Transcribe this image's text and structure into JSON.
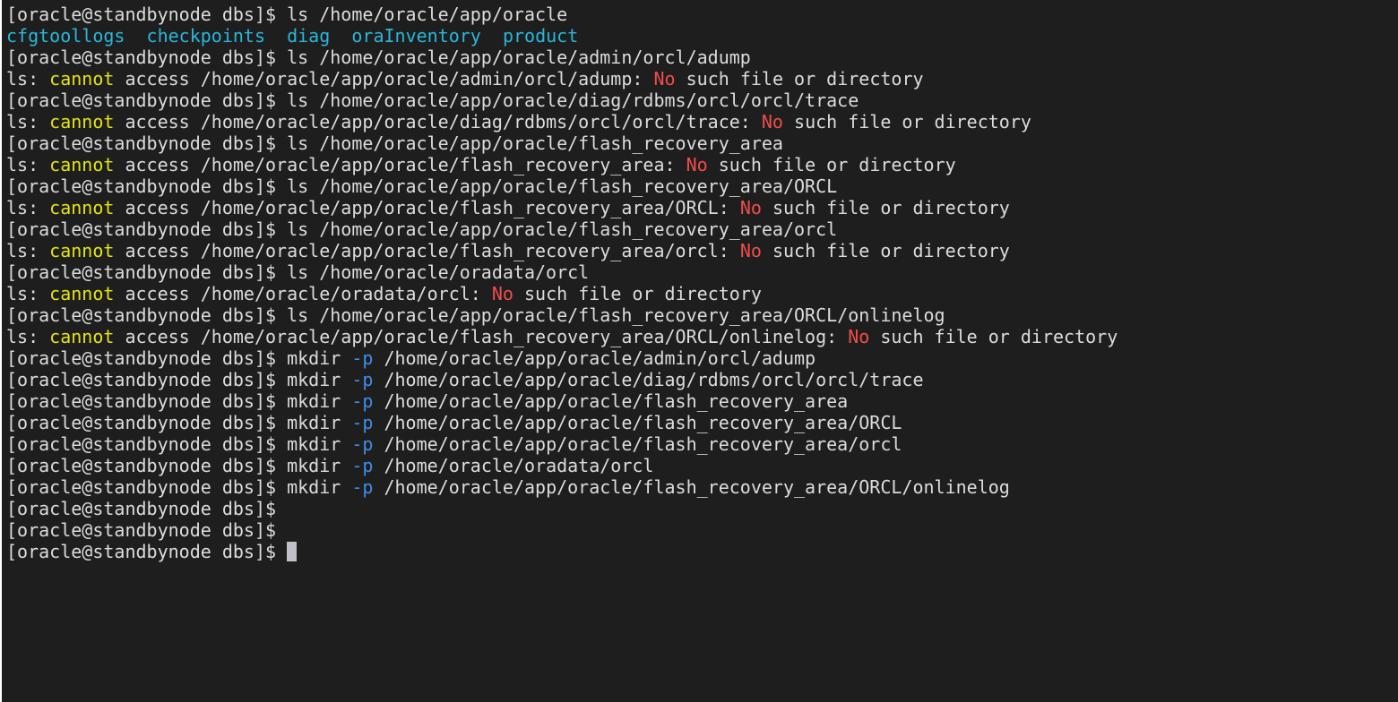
{
  "colors": {
    "background": "#1e1e1e",
    "default_text": "#dcdcdc",
    "directory": "#29b8db",
    "warning": "#e5e510",
    "error": "#f14c4c",
    "option": "#3b8eea",
    "cursor": "#c0c0c8"
  },
  "lines": [
    [
      {
        "t": "[oracle@standbynode dbs]$ ls /home/oracle/app/oracle",
        "c": "default"
      }
    ],
    [
      {
        "t": "cfgtoollogs",
        "c": "dir"
      },
      {
        "t": "  ",
        "c": "default"
      },
      {
        "t": "checkpoints",
        "c": "dir"
      },
      {
        "t": "  ",
        "c": "default"
      },
      {
        "t": "diag",
        "c": "dir"
      },
      {
        "t": "  ",
        "c": "default"
      },
      {
        "t": "oraInventory",
        "c": "dir"
      },
      {
        "t": "  ",
        "c": "default"
      },
      {
        "t": "product",
        "c": "dir"
      }
    ],
    [
      {
        "t": "[oracle@standbynode dbs]$ ls /home/oracle/app/oracle/admin/orcl/adump",
        "c": "default"
      }
    ],
    [
      {
        "t": "ls: ",
        "c": "default"
      },
      {
        "t": "cannot",
        "c": "yellow"
      },
      {
        "t": " access /home/oracle/app/oracle/admin/orcl/adump: ",
        "c": "default"
      },
      {
        "t": "No",
        "c": "red"
      },
      {
        "t": " such file or directory",
        "c": "default"
      }
    ],
    [
      {
        "t": "[oracle@standbynode dbs]$ ls /home/oracle/app/oracle/diag/rdbms/orcl/orcl/trace",
        "c": "default"
      }
    ],
    [
      {
        "t": "ls: ",
        "c": "default"
      },
      {
        "t": "cannot",
        "c": "yellow"
      },
      {
        "t": " access /home/oracle/app/oracle/diag/rdbms/orcl/orcl/trace: ",
        "c": "default"
      },
      {
        "t": "No",
        "c": "red"
      },
      {
        "t": " such file or directory",
        "c": "default"
      }
    ],
    [
      {
        "t": "[oracle@standbynode dbs]$ ls /home/oracle/app/oracle/flash_recovery_area",
        "c": "default"
      }
    ],
    [
      {
        "t": "ls: ",
        "c": "default"
      },
      {
        "t": "cannot",
        "c": "yellow"
      },
      {
        "t": " access /home/oracle/app/oracle/flash_recovery_area: ",
        "c": "default"
      },
      {
        "t": "No",
        "c": "red"
      },
      {
        "t": " such file or directory",
        "c": "default"
      }
    ],
    [
      {
        "t": "[oracle@standbynode dbs]$ ls /home/oracle/app/oracle/flash_recovery_area/ORCL",
        "c": "default"
      }
    ],
    [
      {
        "t": "ls: ",
        "c": "default"
      },
      {
        "t": "cannot",
        "c": "yellow"
      },
      {
        "t": " access /home/oracle/app/oracle/flash_recovery_area/ORCL: ",
        "c": "default"
      },
      {
        "t": "No",
        "c": "red"
      },
      {
        "t": " such file or directory",
        "c": "default"
      }
    ],
    [
      {
        "t": "[oracle@standbynode dbs]$ ls /home/oracle/app/oracle/flash_recovery_area/orcl",
        "c": "default"
      }
    ],
    [
      {
        "t": "ls: ",
        "c": "default"
      },
      {
        "t": "cannot",
        "c": "yellow"
      },
      {
        "t": " access /home/oracle/app/oracle/flash_recovery_area/orcl: ",
        "c": "default"
      },
      {
        "t": "No",
        "c": "red"
      },
      {
        "t": " such file or directory",
        "c": "default"
      }
    ],
    [
      {
        "t": "[oracle@standbynode dbs]$ ls /home/oracle/oradata/orcl",
        "c": "default"
      }
    ],
    [
      {
        "t": "ls: ",
        "c": "default"
      },
      {
        "t": "cannot",
        "c": "yellow"
      },
      {
        "t": " access /home/oracle/oradata/orcl: ",
        "c": "default"
      },
      {
        "t": "No",
        "c": "red"
      },
      {
        "t": " such file or directory",
        "c": "default"
      }
    ],
    [
      {
        "t": "[oracle@standbynode dbs]$ ls /home/oracle/app/oracle/flash_recovery_area/ORCL/onlinelog",
        "c": "default"
      }
    ],
    [
      {
        "t": "ls: ",
        "c": "default"
      },
      {
        "t": "cannot",
        "c": "yellow"
      },
      {
        "t": " access /home/oracle/app/oracle/flash_recovery_area/ORCL/onlinelog: ",
        "c": "default"
      },
      {
        "t": "No",
        "c": "red"
      },
      {
        "t": " such file or directory",
        "c": "default"
      }
    ],
    [
      {
        "t": "[oracle@standbynode dbs]$ mkdir ",
        "c": "default"
      },
      {
        "t": "-p",
        "c": "blue"
      },
      {
        "t": " /home/oracle/app/oracle/admin/orcl/adump",
        "c": "default"
      }
    ],
    [
      {
        "t": "[oracle@standbynode dbs]$ mkdir ",
        "c": "default"
      },
      {
        "t": "-p",
        "c": "blue"
      },
      {
        "t": " /home/oracle/app/oracle/diag/rdbms/orcl/orcl/trace",
        "c": "default"
      }
    ],
    [
      {
        "t": "[oracle@standbynode dbs]$ mkdir ",
        "c": "default"
      },
      {
        "t": "-p",
        "c": "blue"
      },
      {
        "t": " /home/oracle/app/oracle/flash_recovery_area",
        "c": "default"
      }
    ],
    [
      {
        "t": "[oracle@standbynode dbs]$ mkdir ",
        "c": "default"
      },
      {
        "t": "-p",
        "c": "blue"
      },
      {
        "t": " /home/oracle/app/oracle/flash_recovery_area/ORCL",
        "c": "default"
      }
    ],
    [
      {
        "t": "[oracle@standbynode dbs]$ mkdir ",
        "c": "default"
      },
      {
        "t": "-p",
        "c": "blue"
      },
      {
        "t": " /home/oracle/app/oracle/flash_recovery_area/orcl",
        "c": "default"
      }
    ],
    [
      {
        "t": "[oracle@standbynode dbs]$ mkdir ",
        "c": "default"
      },
      {
        "t": "-p",
        "c": "blue"
      },
      {
        "t": " /home/oracle/oradata/orcl",
        "c": "default"
      }
    ],
    [
      {
        "t": "[oracle@standbynode dbs]$ mkdir ",
        "c": "default"
      },
      {
        "t": "-p",
        "c": "blue"
      },
      {
        "t": " /home/oracle/app/oracle/flash_recovery_area/ORCL/onlinelog",
        "c": "default"
      }
    ],
    [
      {
        "t": "[oracle@standbynode dbs]$",
        "c": "default"
      }
    ],
    [
      {
        "t": "[oracle@standbynode dbs]$",
        "c": "default"
      }
    ],
    [
      {
        "t": "[oracle@standbynode dbs]$ ",
        "c": "default"
      }
    ]
  ],
  "cursor": {
    "line": 25
  }
}
